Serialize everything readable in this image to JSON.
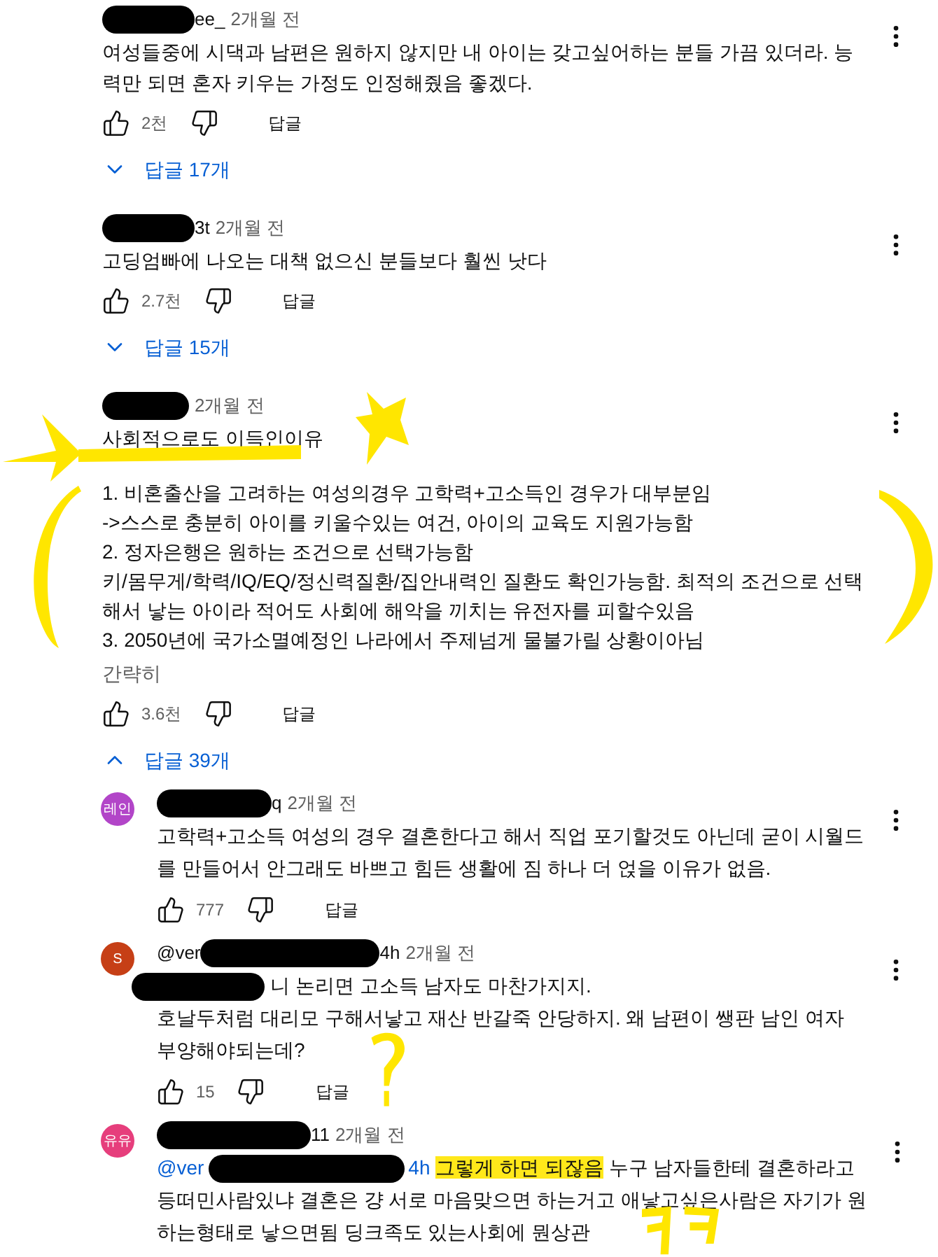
{
  "comments": [
    {
      "author_suffix": "ee_",
      "time": "2개월 전",
      "body": "여성들중에 시댁과 남편은 원하지 않지만 내 아이는 갖고싶어하는 분들 가끔 있더라. 능력만 되면 혼자 키우는 가정도 인정해줬음 좋겠다.",
      "likes": "2천",
      "reply_label": "답글",
      "replies_toggle": {
        "label": "답글 17개",
        "expanded": false
      }
    },
    {
      "author_suffix": "3t",
      "time": "2개월 전",
      "body": "고딩엄빠에 나오는 대책 없으신 분들보다 훨씬 낫다",
      "likes": "2.7천",
      "reply_label": "답글",
      "replies_toggle": {
        "label": "답글 15개",
        "expanded": false
      }
    },
    {
      "time": "2개월 전",
      "title": "사회적으로도 이득인이유",
      "body_lines": [
        "1. 비혼출산을 고려하는 여성의경우 고학력+고소득인 경우가 대부분임",
        "->스스로 충분히 아이를 키울수있는 여건, 아이의 교육도 지원가능함",
        "2. 정자은행은 원하는 조건으로 선택가능함",
        "키/몸무게/학력/IQ/EQ/정신력질환/집안내력인 질환도 확인가능함. 최적의 조건으로 선택해서 낳는 아이라 적어도 사회에 해악을 끼치는 유전자를 피할수있음",
        "3. 2050년에 국가소멸예정인 나라에서 주제넘게 물불가릴 상황이아님"
      ],
      "collapse_label": "간략히",
      "likes": "3.6천",
      "reply_label": "답글",
      "replies_toggle": {
        "label": "답글 39개",
        "expanded": true
      },
      "replies": [
        {
          "avatar": {
            "text": "레인",
            "color": "#b245c8"
          },
          "author_suffix": "q",
          "time": "2개월 전",
          "body": "고학력+고소득 여성의 경우 결혼한다고 해서 직업 포기할것도 아닌데 굳이 시월드를 만들어서 안그래도 바쁘고 힘든 생활에 짐 하나 더 얹을 이유가 없음.",
          "likes": "777",
          "reply_label": "답글"
        },
        {
          "avatar": {
            "text": "S",
            "color": "#c63f16"
          },
          "author_prefix": "@ver",
          "author_suffix": "4h",
          "time": "2개월 전",
          "body_hidden_start": true,
          "body_lines": [
            "니 논리면 고소득 남자도 마찬가지지.",
            "호날두처럼 대리모 구해서낳고 재산 반갈죽 안당하지.  왜 남편이  쌩판 남인 여자",
            "부양해야되는데?"
          ],
          "likes": "15",
          "reply_label": "답글"
        },
        {
          "avatar": {
            "text": "유유",
            "color": "#e63e7c"
          },
          "author_suffix": "11",
          "time": "2개월 전",
          "segments": [
            {
              "kind": "mention",
              "text": "@ver"
            },
            {
              "kind": "hidden"
            },
            {
              "kind": "mention",
              "text": "4h"
            },
            {
              "kind": "text",
              "text": "그렇게 하면 되잖음",
              "highlighted": true
            },
            {
              "kind": "text",
              "text": "누구 남자들한테 결혼하라고",
              "highlighted": false
            },
            {
              "kind": "break"
            },
            {
              "kind": "text",
              "text": "등떠민사람있냐 결혼은 걍 서로 마음맞으면 하는거고 애낳고싶은사람은 자기가 원",
              "highlighted": false
            },
            {
              "kind": "break"
            },
            {
              "kind": "text",
              "text": "하는형태로 낳으면됨 딩크족도 있는사회에 뭔상관",
              "highlighted": false
            }
          ]
        }
      ]
    }
  ]
}
